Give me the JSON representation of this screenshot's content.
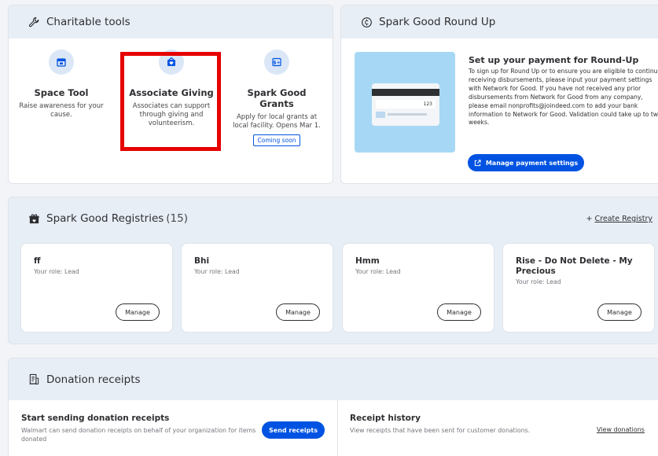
{
  "charitable_tools": {
    "title": "Charitable tools",
    "tools": [
      {
        "name": "Space Tool",
        "description": "Raise awareness for your cause."
      },
      {
        "name": "Associate Giving",
        "description": "Associates can support through giving and volunteerism."
      },
      {
        "name": "Spark Good Grants",
        "description": "Apply for local grants at local facility. Opens Mar 1.",
        "badge": "Coming soon"
      }
    ]
  },
  "round_up": {
    "title": "Spark Good Round Up",
    "heading": "Set up your payment for Round-Up",
    "body": "To sign up for Round Up or to ensure you are eligible to continue receiving disbursements, please input your payment settings with Network for Good. If you have not received any prior disbursements from Network for Good from any company, please email nonprofits@joindeed.com to add your bank information to Network for Good. Validation could take up to two weeks.",
    "card_number": "123",
    "button": "Manage payment settings"
  },
  "registries": {
    "title": "Spark Good Registries",
    "count": "(15)",
    "create_prefix": "+",
    "create_label": "Create Registry",
    "items": [
      {
        "name": "ff",
        "role": "Your role: Lead",
        "button": "Manage"
      },
      {
        "name": "Bhi",
        "role": "Your role: Lead",
        "button": "Manage"
      },
      {
        "name": "Hmm",
        "role": "Your role: Lead",
        "button": "Manage"
      },
      {
        "name": "Rise - Do Not Delete - My Precious",
        "role": "Your role: Lead",
        "button": "Manage"
      }
    ]
  },
  "donations": {
    "title": "Donation receipts",
    "start_title": "Start sending donation receipts",
    "start_text": "Walmart can send donation receipts on behalf of your organization for items donated",
    "send_button": "Send receipts",
    "history_title": "Receipt history",
    "history_text": "View receipts that have been sent for customer donations.",
    "view_link": "View donations"
  },
  "colors": {
    "accent": "#0053e2",
    "highlight": "#e60000",
    "header_bg": "#e8eef6"
  }
}
